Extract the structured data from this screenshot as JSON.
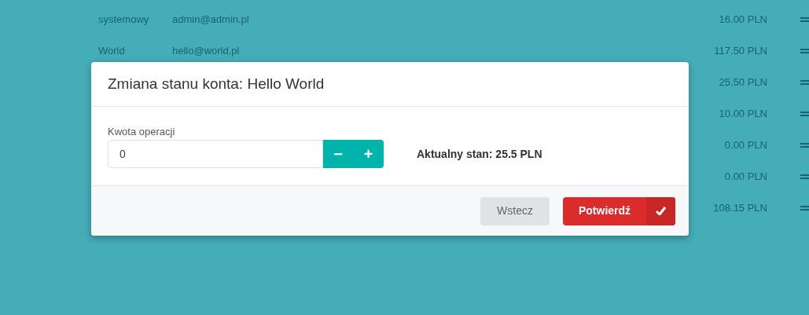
{
  "table": {
    "rows": [
      {
        "name": "systemowy",
        "email": "admin@admin.pl",
        "balance": "16.00 PLN"
      },
      {
        "name": "World",
        "email": "hello@world.pl",
        "balance": "117.50 PLN"
      },
      {
        "balance": "25.50 PLN"
      },
      {
        "balance": "10.00 PLN"
      },
      {
        "balance": "0.00 PLN"
      },
      {
        "balance": "0.00 PLN"
      },
      {
        "balance": "108.15 PLN"
      }
    ]
  },
  "modal": {
    "title": "Zmiana stanu konta: Hello World",
    "amount_label": "Kwota operacji",
    "amount_value": "0",
    "minus": "−",
    "plus": "+",
    "current_balance": "Aktualny stan: 25.5 PLN",
    "back_button": "Wstecz",
    "confirm_button": "Potwierdź"
  }
}
